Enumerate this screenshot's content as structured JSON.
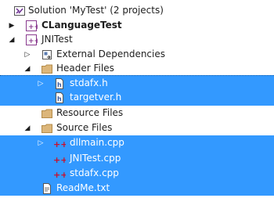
{
  "tree": {
    "solution_label": "Solution 'MyTest' (2 projects)",
    "items": {
      "clanguagetest": "CLanguageTest",
      "jnitest": "JNITest",
      "external_dependencies": "External Dependencies",
      "header_files": "Header Files",
      "stdafx_h": "stdafx.h",
      "targetver_h": "targetver.h",
      "resource_files": "Resource Files",
      "source_files": "Source Files",
      "dllmain_cpp": "dllmain.cpp",
      "jnitest_cpp": "JNITest.cpp",
      "stdafx_cpp": "stdafx.cpp",
      "readme_txt": "ReadMe.txt"
    }
  },
  "colors": {
    "selection": "#3399ff",
    "folder": "#dcb67a",
    "cpp_icon": "#c8102e"
  }
}
